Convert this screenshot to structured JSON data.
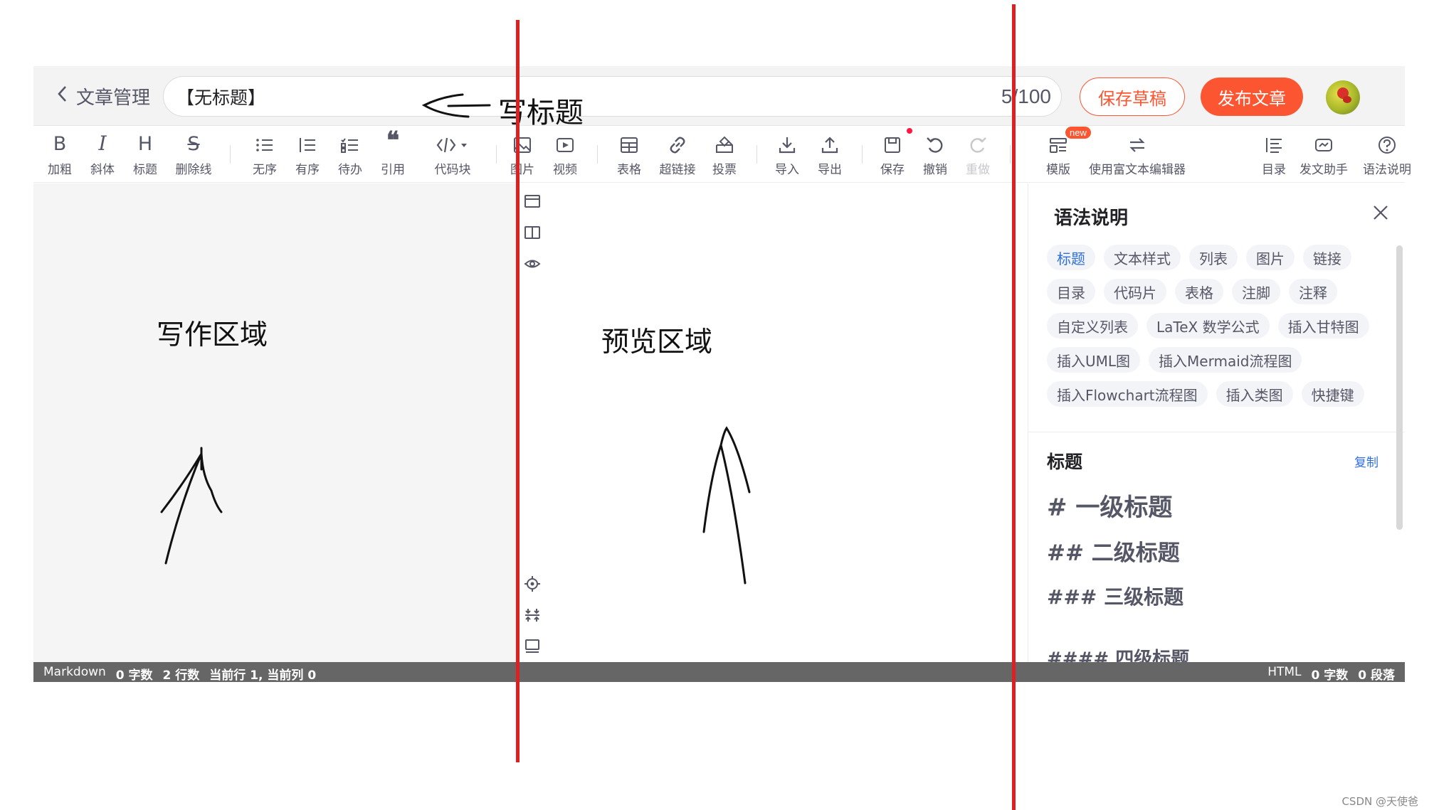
{
  "header": {
    "back_label": "文章管理",
    "title_value": "【无标题】",
    "title_count": "5/100",
    "annotation_title": "写标题",
    "save_draft": "保存草稿",
    "publish": "发布文章"
  },
  "toolbar": {
    "bold": "加粗",
    "bold_glyph": "B",
    "italic": "斜体",
    "italic_glyph": "I",
    "heading": "标题",
    "heading_glyph": "H",
    "strike": "删除线",
    "strike_glyph": "S",
    "unordered": "无序",
    "ordered": "有序",
    "todo": "待办",
    "quote": "引用",
    "codeblock": "代码块",
    "image": "图片",
    "video": "视频",
    "table": "表格",
    "link": "超链接",
    "vote": "投票",
    "import": "导入",
    "export": "导出",
    "save": "保存",
    "undo": "撤销",
    "redo": "重做",
    "template": "模版",
    "template_badge": "new",
    "rich_editor": "使用富文本编辑器",
    "toc": "目录",
    "assistant": "发文助手",
    "syntax": "语法说明"
  },
  "panes": {
    "write_label": "写作区域",
    "preview_label": "预览区域"
  },
  "help": {
    "title": "语法说明",
    "tags": [
      "标题",
      "文本样式",
      "列表",
      "图片",
      "链接",
      "目录",
      "代码片",
      "表格",
      "注脚",
      "注释",
      "自定义列表",
      "LaTeX 数学公式",
      "插入甘特图",
      "插入UML图",
      "插入Mermaid流程图",
      "插入Flowchart流程图",
      "插入类图",
      "快捷键"
    ],
    "active_tag": "标题",
    "section_title": "标题",
    "copy": "复制",
    "h1": "# 一级标题",
    "h2": "## 二级标题",
    "h3": "### 三级标题",
    "h4": "#### 四级标题"
  },
  "status": {
    "mode": "Markdown",
    "words": "0 字数",
    "lines": "2 行数",
    "cursor": "当前行 1, 当前列 0",
    "html": "HTML",
    "html_words": "0 字数",
    "paragraphs": "0 段落"
  },
  "watermark": "CSDN @天使爸",
  "colors": {
    "accent": "#fc5531",
    "link": "#2e6fdd",
    "annotation_line": "#e02020",
    "status_bar": "#666666"
  }
}
